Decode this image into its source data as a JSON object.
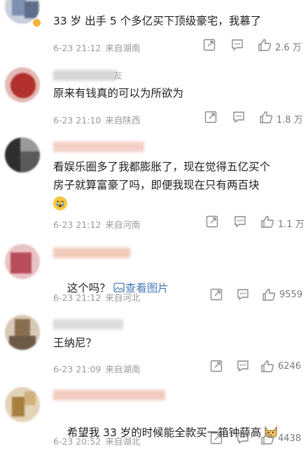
{
  "comments": [
    {
      "username_hint": "",
      "text": "33 岁 出手 5 个多亿买下顶级豪宅，我慕了",
      "date": "6-23 21:12",
      "source": "来自湖南",
      "likes": "2.6 万",
      "avatar_color": "#8aa0c2"
    },
    {
      "username_hint": "友",
      "text": "原来有钱真的可以为所欲为",
      "date": "6-23 21:10",
      "source": "来自陕西",
      "likes": "1.8 万",
      "avatar_color": "#b5302e"
    },
    {
      "username_hint": "",
      "text": "看娱乐圈多了我都膨胀了，现在觉得五亿买个\n房子就算富豪了吗，即便我现在只有两百块",
      "date": "6-23 21:12",
      "source": "来自河南",
      "likes": "1.1 万",
      "avatar_color": "#3c3c3c"
    },
    {
      "username_hint": "",
      "text": "这个吗？",
      "link_text": "查看图片",
      "date": "6-23 21:12",
      "source": "来自河北",
      "likes": "9559",
      "avatar_color": "#c26f75"
    },
    {
      "username_hint": "",
      "text": "王纳尼？",
      "date": "6-23 21:09",
      "source": "来自湖南",
      "likes": "6246",
      "avatar_color": "#a08a72"
    },
    {
      "username_hint": "",
      "text": "希望我 33 岁的时候能全款买一箱钟薛高",
      "date": "6-23 20:52",
      "source": "来自湖北",
      "likes": "4438",
      "avatar_color": "#b89a6a"
    }
  ],
  "colors": {
    "accent_link": "#4a7bb7",
    "meta": "#9a9a9a",
    "icon": "#8a8a8a"
  }
}
